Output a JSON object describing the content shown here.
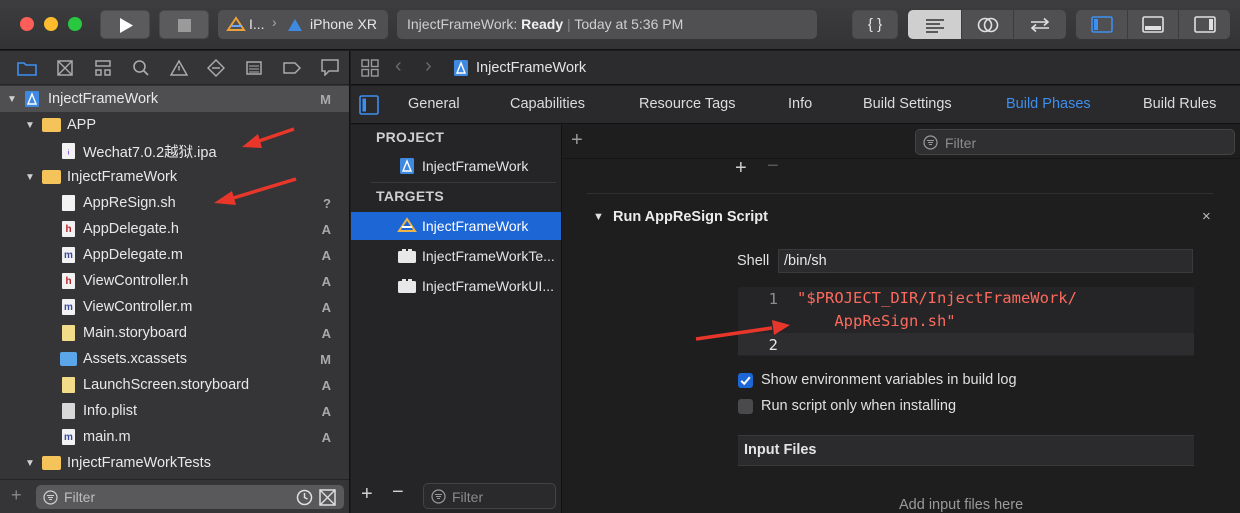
{
  "toolbar": {
    "scheme_target": "I...",
    "scheme_device": "iPhone XR",
    "status_project": "InjectFrameWork:",
    "status_state": "Ready",
    "status_separator": "|",
    "status_time": "Today at 5:36 PM",
    "code_review_label": "{ }"
  },
  "navigator": {
    "items": [
      {
        "label": "InjectFrameWork",
        "badge": "M",
        "kind": "project",
        "indent": 0
      },
      {
        "label": "APP",
        "badge": "",
        "kind": "folder",
        "indent": 1
      },
      {
        "label": "Wechat7.0.2越狱.ipa",
        "badge": "",
        "kind": "ipa",
        "indent": 2
      },
      {
        "label": "InjectFrameWork",
        "badge": "",
        "kind": "folder",
        "indent": 1
      },
      {
        "label": "AppReSign.sh",
        "badge": "?",
        "kind": "sh",
        "indent": 2
      },
      {
        "label": "AppDelegate.h",
        "badge": "A",
        "kind": "h",
        "indent": 2
      },
      {
        "label": "AppDelegate.m",
        "badge": "A",
        "kind": "m",
        "indent": 2
      },
      {
        "label": "ViewController.h",
        "badge": "A",
        "kind": "h",
        "indent": 2
      },
      {
        "label": "ViewController.m",
        "badge": "A",
        "kind": "m",
        "indent": 2
      },
      {
        "label": "Main.storyboard",
        "badge": "A",
        "kind": "storyboard",
        "indent": 2
      },
      {
        "label": "Assets.xcassets",
        "badge": "M",
        "kind": "assets",
        "indent": 2
      },
      {
        "label": "LaunchScreen.storyboard",
        "badge": "A",
        "kind": "storyboard",
        "indent": 2
      },
      {
        "label": "Info.plist",
        "badge": "A",
        "kind": "plist",
        "indent": 2
      },
      {
        "label": "main.m",
        "badge": "A",
        "kind": "m",
        "indent": 2
      },
      {
        "label": "InjectFrameWorkTests",
        "badge": "",
        "kind": "folder",
        "indent": 1
      }
    ],
    "filter_placeholder": "Filter"
  },
  "editor": {
    "breadcrumb": "InjectFrameWork",
    "tabs": [
      "General",
      "Capabilities",
      "Resource Tags",
      "Info",
      "Build Settings",
      "Build Phases",
      "Build Rules"
    ],
    "active_tab": "Build Phases",
    "project_header": "PROJECT",
    "project_item": "InjectFrameWork",
    "targets_header": "TARGETS",
    "targets": [
      "InjectFrameWork",
      "InjectFrameWorkTe...",
      "InjectFrameWorkUI..."
    ],
    "targets_filter_placeholder": "Filter",
    "phases_filter_placeholder": "Filter",
    "phase_title": "Run AppReSign Script",
    "shell_label": "Shell",
    "shell_value": "/bin/sh",
    "code_lines": [
      {
        "num": "1",
        "text": "\"$PROJECT_DIR/InjectFrameWork/",
        "cont": "    AppReSign.sh\""
      },
      {
        "num": "2",
        "text": ""
      }
    ],
    "checkbox_env": "Show environment variables in build log",
    "checkbox_install": "Run script only when installing",
    "input_files_header": "Input Files",
    "input_files_hint": "Add input files here"
  },
  "colors": {
    "accent": "#1c66d6",
    "active_tab": "#3d8ff0",
    "code_string": "#fc6a5d",
    "arrow": "#e8362b",
    "folder": "#f4c35a"
  }
}
